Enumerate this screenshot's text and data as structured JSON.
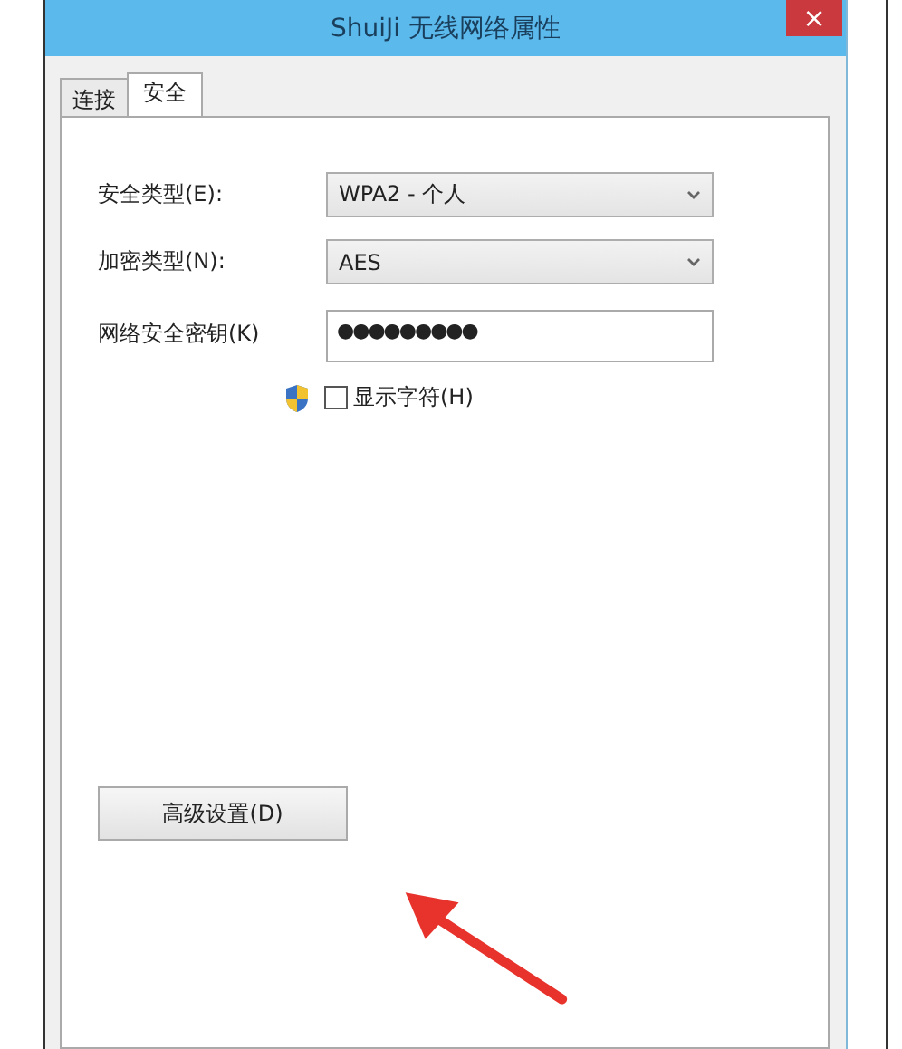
{
  "window": {
    "title": "ShuiJi 无线网络属性",
    "close": "×"
  },
  "tabs": [
    {
      "label": "连接",
      "selected": false
    },
    {
      "label": "安全",
      "selected": true
    }
  ],
  "fields": [
    {
      "kind": "select",
      "label": "安全类型(E):",
      "value": "WPA2 - 个人"
    },
    {
      "kind": "select",
      "label": "加密类型(N):",
      "value": "AES"
    },
    {
      "kind": "password",
      "label": "网络安全密钥(K)",
      "value": "●●●●●●●●●"
    }
  ],
  "show_characters": {
    "label": "显示字符(H)",
    "checked": false
  },
  "advanced_button": "高级设置(D)"
}
